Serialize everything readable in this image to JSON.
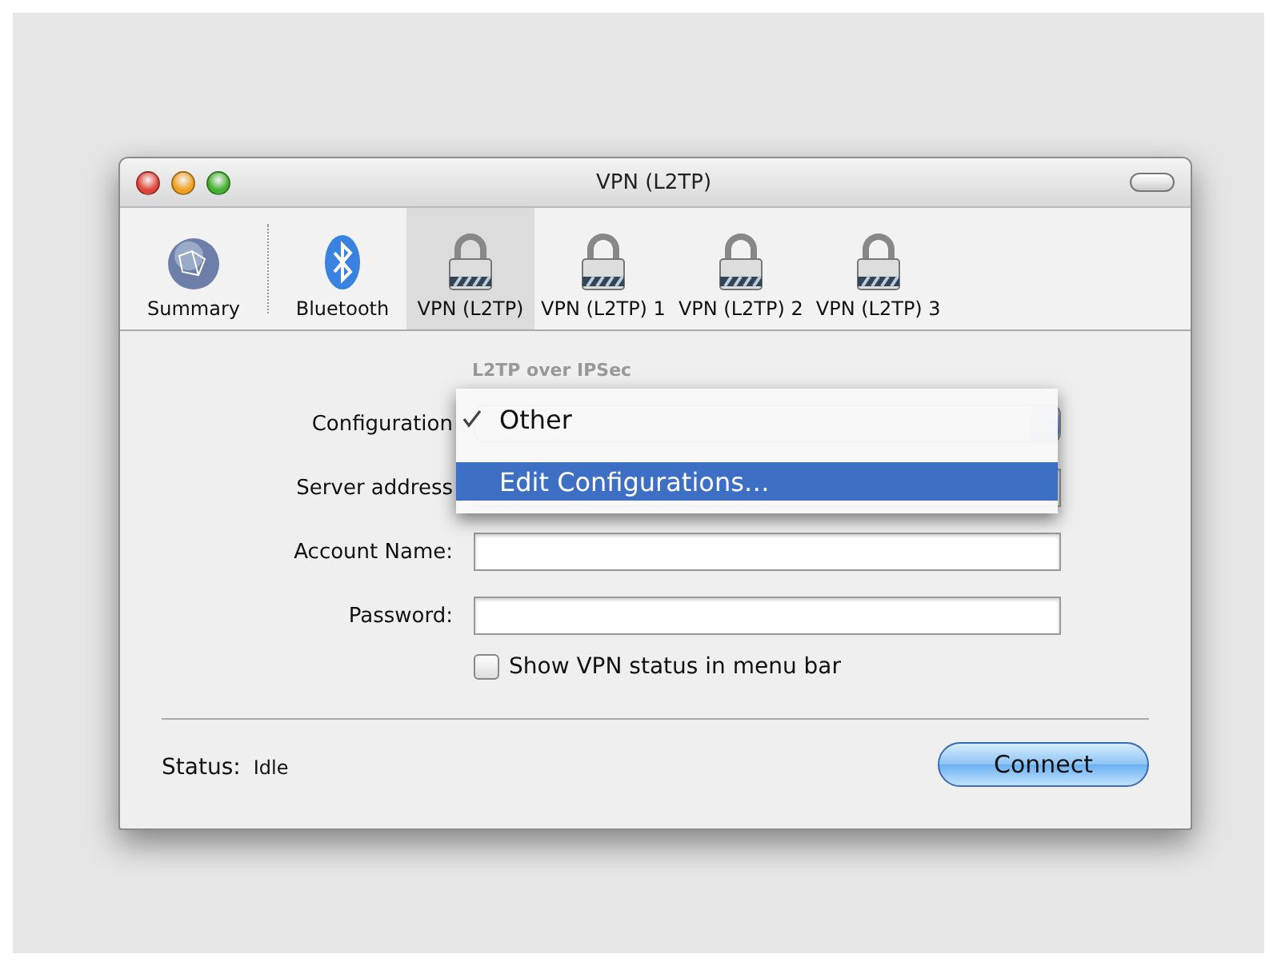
{
  "window": {
    "title": "VPN (L2TP)"
  },
  "toolbar": [
    {
      "label": "Summary",
      "kind": "globe",
      "selected": false
    },
    {
      "label": "Bluetooth",
      "kind": "bluetooth",
      "selected": false
    },
    {
      "label": "VPN (L2TP)",
      "kind": "lock",
      "selected": true
    },
    {
      "label": "VPN (L2TP) 1",
      "kind": "lock",
      "selected": false
    },
    {
      "label": "VPN (L2TP) 2",
      "kind": "lock",
      "selected": false
    },
    {
      "label": "VPN (L2TP) 3",
      "kind": "lock",
      "selected": false
    }
  ],
  "subtitle": "L2TP over IPSec",
  "form": [
    {
      "label": "Configuration",
      "kind": "popup"
    },
    {
      "label": "Server address",
      "kind": "field"
    },
    {
      "label": "Account Name:",
      "kind": "field"
    },
    {
      "label": "Password:",
      "kind": "field"
    }
  ],
  "checkbox": {
    "label": "Show VPN status in menu bar",
    "checked": false
  },
  "popup_menu": [
    {
      "label": "Other",
      "checked": true,
      "selected": false
    },
    {
      "label": "Edit Configurations…",
      "checked": false,
      "selected": true
    }
  ],
  "status": {
    "label": "Status:",
    "value": "Idle"
  },
  "connect_button": "Connect"
}
